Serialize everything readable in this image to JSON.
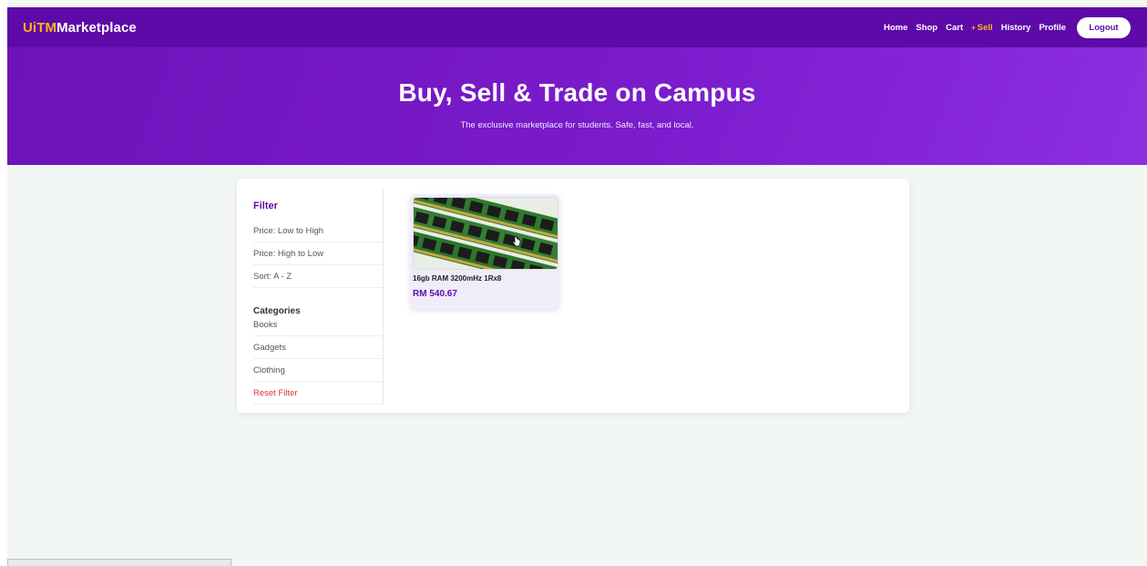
{
  "brand": {
    "part1": "UiTM",
    "part2": "Marketplace"
  },
  "nav": {
    "items": [
      {
        "label": "Home"
      },
      {
        "label": "Shop"
      },
      {
        "label": "Cart"
      },
      {
        "label": "Sell"
      },
      {
        "label": "History"
      },
      {
        "label": "Profile"
      }
    ],
    "active": "Sell",
    "logout_label": "Logout"
  },
  "hero": {
    "title": "Buy, Sell & Trade on Campus",
    "subtitle": "The exclusive marketplace for students. Safe, fast, and local."
  },
  "sidebar": {
    "heading": "Filter",
    "sort_options": [
      "Price: Low to High",
      "Price: High to Low",
      "Sort: A - Z"
    ],
    "categories_heading": "Categories",
    "categories": [
      "Books",
      "Gadgets",
      "Clothing"
    ],
    "reset_label": "Reset Filter"
  },
  "products": [
    {
      "name": "16gb RAM 3200mHz 1Rx8",
      "price": "RM 540.67"
    }
  ],
  "colors": {
    "primary": "#5d0aa8",
    "accent": "#ffb31a",
    "reset": "#d93030"
  }
}
